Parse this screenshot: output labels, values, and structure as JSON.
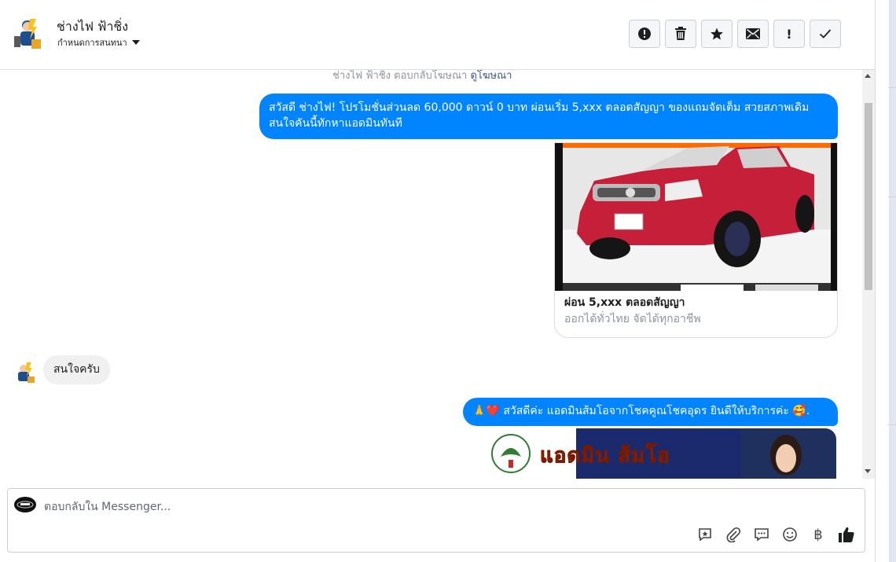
{
  "header": {
    "page_name": "ช่างไฟ ฟ้าชิ่ง",
    "assign_label": "กำหนดการสนทนา",
    "toolbar": [
      {
        "name": "alert-circle",
        "label": "!"
      },
      {
        "name": "trash",
        "label": ""
      },
      {
        "name": "star",
        "label": ""
      },
      {
        "name": "mail",
        "label": ""
      },
      {
        "name": "exclamation",
        "label": "!"
      },
      {
        "name": "check",
        "label": ""
      }
    ]
  },
  "thread": {
    "ad_note": "ช่างไฟ ฟ้าชิ่ง ตอบกลับโฆษณา",
    "ad_link": "ดูโฆษณา",
    "msg1": "สวัสดี ช่างไฟ! โปรโมชั่นส่วนลด 60,000 ดาวน์ 0 บาท ผ่อนเริ่ม 5,xxx ตลอดสัญญา ของแถมจัดเต็ม สวยสภาพเดิม สนใจคันนี้ทักหาแอดมินทันที",
    "card_title": "ผ่อน 5,xxx ตลอดสัญญา",
    "card_sub": "ออกได้ทั่วไทย จัดได้ทุกอาชีพ",
    "reply": "สนใจครับ",
    "msg2": "🙏❤️ สวัสดีค่ะ แอดมินส้มโอจากโชคคูณโชคอุดร ยินดีให้บริการค่ะ 🥰.",
    "promo_text": "แอดมิน ส้มโอ"
  },
  "composer": {
    "placeholder": "ตอบกลับใน Messenger...",
    "tools": [
      "saved-reply",
      "attach",
      "chat",
      "emoji",
      "baht",
      "like"
    ],
    "baht_symbol": "฿"
  },
  "colors": {
    "accent": "#0084ff",
    "incoming_bubble": "#f1f0f0",
    "muted_text": "#8d949e",
    "link": "#385898"
  }
}
